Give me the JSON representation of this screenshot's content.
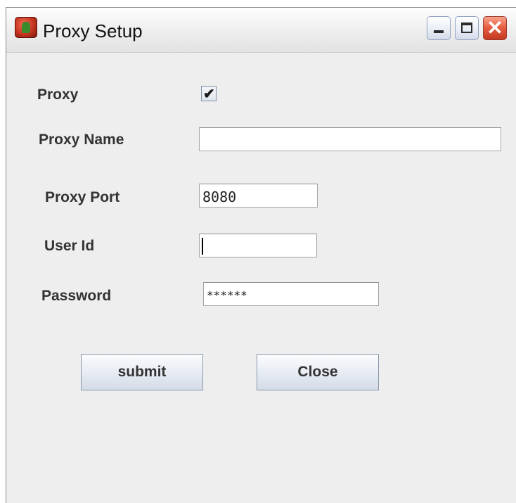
{
  "window": {
    "title": "Proxy Setup",
    "controls": {
      "minimize_icon": "minimize-icon",
      "maximize_icon": "maximize-icon",
      "close_glyph": "✕"
    }
  },
  "form": {
    "proxy_label": "Proxy",
    "proxy_checked": true,
    "check_glyph": "✔",
    "proxy_name_label": "Proxy Name",
    "proxy_name_value": "",
    "proxy_port_label": "Proxy Port",
    "proxy_port_value": "8080",
    "user_id_label": "User Id",
    "user_id_value": "",
    "password_label": "Password",
    "password_value": "******"
  },
  "buttons": {
    "submit_label": "submit",
    "close_label": "Close"
  }
}
